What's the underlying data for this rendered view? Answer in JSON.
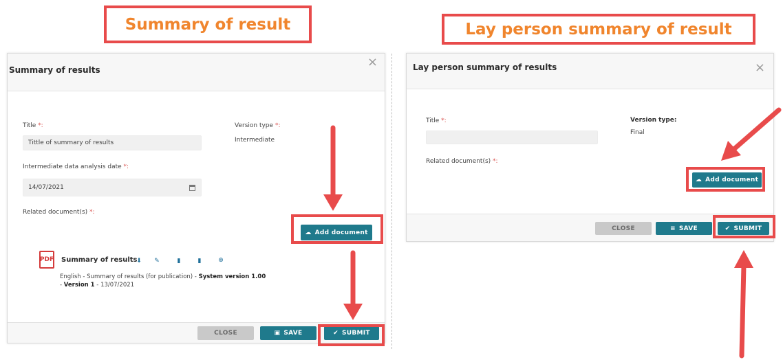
{
  "captions": {
    "left": "Summary of result",
    "right": "Lay person summary of result"
  },
  "left_dialog": {
    "title": "Summary of results",
    "close_glyph": "×",
    "title_label": "Title",
    "required_mark": "*:",
    "title_value": "Tittle of summary of results",
    "version_type_label": "Version type",
    "version_type_value": "Intermediate",
    "date_label": "Intermediate data analysis date",
    "date_value": "14/07/2021",
    "related_label": "Related document(s)",
    "add_document": "Add document",
    "document": {
      "title": "Summary of results",
      "pdf_label": "PDF",
      "meta_prefix": "English - Summary of results (for publication) - ",
      "system_version": "System version 1.00",
      "meta_sep": "- ",
      "version": "Version 1",
      "meta_date": " - 13/07/2021"
    },
    "buttons": {
      "close": "CLOSE",
      "save": "SAVE",
      "submit": "SUBMIT"
    }
  },
  "right_dialog": {
    "title": "Lay person summary of results",
    "close_glyph": "×",
    "title_label": "Title",
    "required_mark": "*:",
    "title_value": "",
    "version_type_label": "Version type:",
    "version_type_value": "Final",
    "related_label": "Related document(s)",
    "add_document": "Add document",
    "buttons": {
      "close": "CLOSE",
      "save": "SAVE",
      "submit": "SUBMIT"
    }
  },
  "colors": {
    "accent_teal": "#1f7a8c",
    "highlight_red": "#e84b4b",
    "caption_orange": "#f0852d"
  }
}
